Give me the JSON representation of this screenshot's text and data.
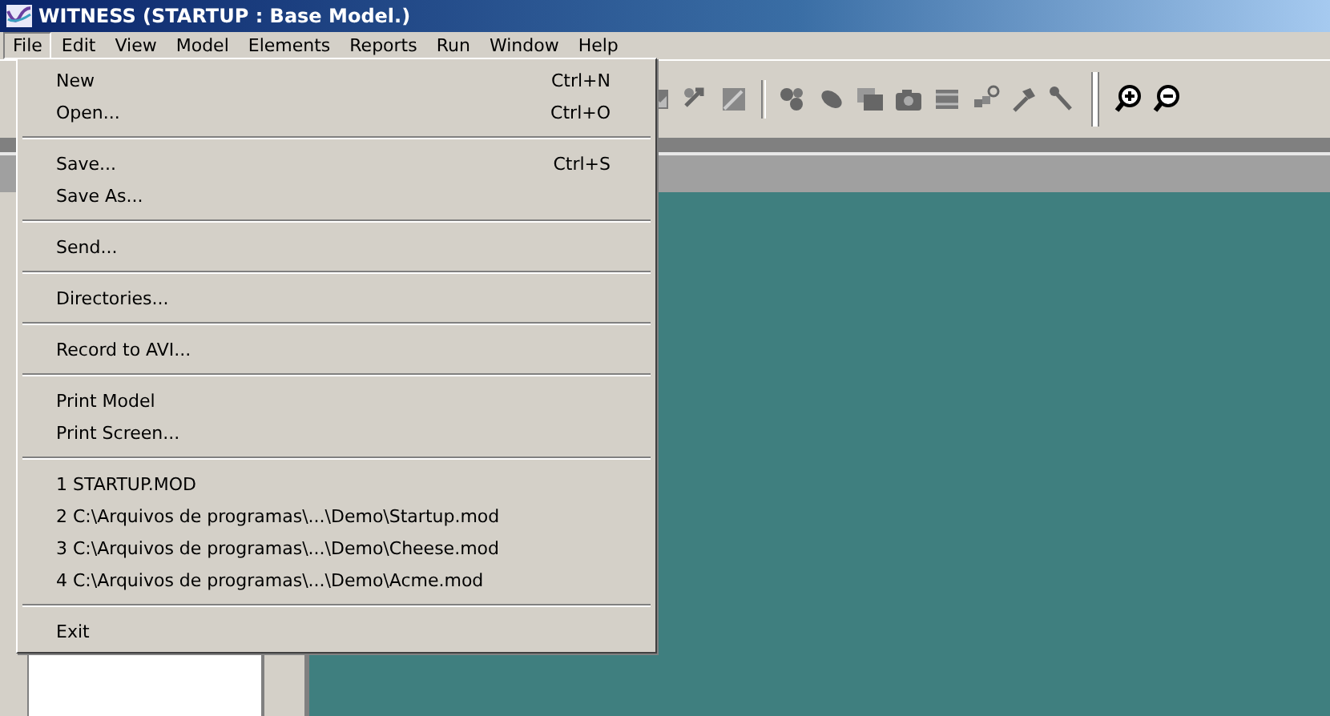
{
  "window": {
    "title": "WITNESS (STARTUP : Base Model.)"
  },
  "menu_bar": [
    {
      "label": "File",
      "selected": true
    },
    {
      "label": "Edit",
      "selected": false
    },
    {
      "label": "View",
      "selected": false
    },
    {
      "label": "Model",
      "selected": false
    },
    {
      "label": "Elements",
      "selected": false
    },
    {
      "label": "Reports",
      "selected": false
    },
    {
      "label": "Run",
      "selected": false
    },
    {
      "label": "Window",
      "selected": false
    },
    {
      "label": "Help",
      "selected": false
    }
  ],
  "file_menu": {
    "groups": [
      [
        {
          "label": "New",
          "shortcut": "Ctrl+N"
        },
        {
          "label": "Open...",
          "shortcut": "Ctrl+O"
        }
      ],
      [
        {
          "label": "Save...",
          "shortcut": "Ctrl+S"
        },
        {
          "label": "Save As..."
        }
      ],
      [
        {
          "label": "Send..."
        }
      ],
      [
        {
          "label": "Directories..."
        }
      ],
      [
        {
          "label": "Record to AVI..."
        }
      ],
      [
        {
          "label": "Print Model"
        },
        {
          "label": "Print Screen..."
        }
      ],
      [
        {
          "label": "1 STARTUP.MOD"
        },
        {
          "label": "2 C:\\Arquivos de programas\\...\\Demo\\Startup.mod"
        },
        {
          "label": "3 C:\\Arquivos de programas\\...\\Demo\\Cheese.mod"
        },
        {
          "label": "4 C:\\Arquivos de programas\\...\\Demo\\Acme.mod"
        }
      ],
      [
        {
          "label": "Exit"
        }
      ]
    ]
  }
}
